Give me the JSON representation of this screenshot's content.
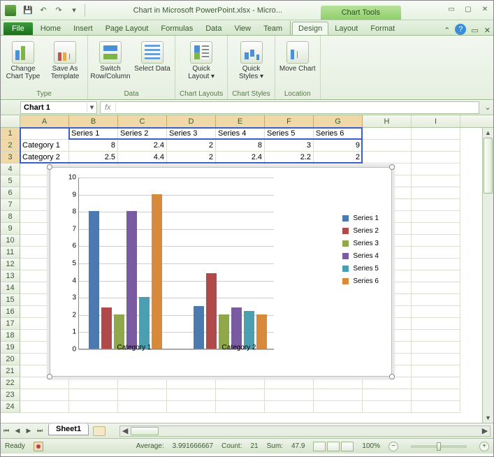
{
  "titlebar": {
    "title": "Chart in Microsoft PowerPoint.xlsx - Micro...",
    "context_label": "Chart Tools"
  },
  "tabs": {
    "file": "File",
    "main_tabs": [
      "Home",
      "Insert",
      "Page Layout",
      "Formulas",
      "Data",
      "View",
      "Team"
    ],
    "context_tabs": [
      "Design",
      "Layout",
      "Format"
    ],
    "active": "Design"
  },
  "ribbon": {
    "groups": [
      {
        "label": "Type",
        "buttons": [
          {
            "label": "Change\nChart Type",
            "cls": "change",
            "name": "change-chart-type-button"
          },
          {
            "label": "Save As\nTemplate",
            "cls": "save",
            "name": "save-as-template-button"
          }
        ]
      },
      {
        "label": "Data",
        "buttons": [
          {
            "label": "Switch\nRow/Column",
            "cls": "switch",
            "name": "switch-row-column-button"
          },
          {
            "label": "Select\nData",
            "cls": "selectd",
            "name": "select-data-button"
          }
        ]
      },
      {
        "label": "Chart Layouts",
        "buttons": [
          {
            "label": "Quick\nLayout ▾",
            "cls": "qlayout",
            "name": "quick-layout-button"
          }
        ]
      },
      {
        "label": "Chart Styles",
        "buttons": [
          {
            "label": "Quick\nStyles ▾",
            "cls": "qstyles",
            "name": "quick-styles-button"
          }
        ]
      },
      {
        "label": "Location",
        "buttons": [
          {
            "label": "Move\nChart",
            "cls": "move",
            "name": "move-chart-button"
          }
        ]
      }
    ]
  },
  "namebox": {
    "value": "Chart 1"
  },
  "columns": [
    "A",
    "B",
    "C",
    "D",
    "E",
    "F",
    "G",
    "H",
    "I"
  ],
  "selected_cols": [
    "A",
    "B",
    "C",
    "D",
    "E",
    "F",
    "G"
  ],
  "table": {
    "row_labels": [
      "Category 1",
      "Category 2"
    ],
    "col_labels": [
      "Series 1",
      "Series 2",
      "Series 3",
      "Series 4",
      "Series 5",
      "Series 6"
    ],
    "data": [
      [
        8,
        2.4,
        2,
        8,
        3,
        9
      ],
      [
        2.5,
        4.4,
        2,
        2.4,
        2.2,
        2
      ]
    ]
  },
  "chart_data": {
    "type": "bar",
    "categories": [
      "Category 1",
      "Category 2"
    ],
    "series": [
      {
        "name": "Series 1",
        "values": [
          8,
          2.5
        ],
        "color": "#4a7ab0"
      },
      {
        "name": "Series 2",
        "values": [
          2.4,
          4.4
        ],
        "color": "#b04a4a"
      },
      {
        "name": "Series 3",
        "values": [
          2,
          2
        ],
        "color": "#8fa84a"
      },
      {
        "name": "Series 4",
        "values": [
          8,
          2.4
        ],
        "color": "#7a5aa0"
      },
      {
        "name": "Series 5",
        "values": [
          3,
          2.2
        ],
        "color": "#4aa0b0"
      },
      {
        "name": "Series 6",
        "values": [
          9,
          2
        ],
        "color": "#d88a3a"
      }
    ],
    "ylim": [
      0,
      10
    ],
    "yticks": [
      0,
      1,
      2,
      3,
      4,
      5,
      6,
      7,
      8,
      9,
      10
    ]
  },
  "sheet_tabs": {
    "active": "Sheet1"
  },
  "statusbar": {
    "mode": "Ready",
    "avg_label": "Average:",
    "avg": "3.991666667",
    "count_label": "Count:",
    "count": "21",
    "sum_label": "Sum:",
    "sum": "47.9",
    "zoom": "100%"
  }
}
